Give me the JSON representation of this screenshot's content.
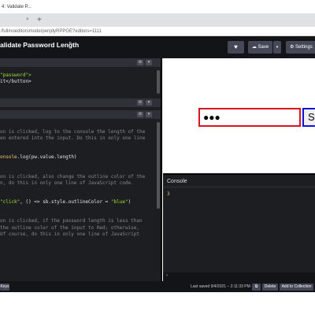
{
  "browser": {
    "tab_title": "4: Validate P...",
    "close_glyph": "×",
    "new_tab_glyph": "+",
    "url": "/full/noeditorsmode/penjdyRPPGE?editors=1111"
  },
  "header": {
    "pen_title": "alidate Password Length",
    "heart_glyph": "♥",
    "save_label": "☁ Save",
    "save_arrow": "▾",
    "settings_label": "⚙ Settings"
  },
  "editors": {
    "html_lines": [
      [
        {
          "t": "\"password\">",
          "c": "str"
        }
      ],
      [
        {
          "t": "it",
          "c": "pl"
        },
        {
          "t": "</button>",
          "c": "tg"
        }
      ]
    ],
    "js_lines": [
      [
        {
          "t": "on is clicked, log to the console the length of the",
          "c": "cm"
        }
      ],
      [
        {
          "t": "en entered into the input. Do this in only one line",
          "c": "cm"
        }
      ],
      [],
      [],
      [
        {
          "t": "onsole",
          "c": "fn"
        },
        {
          "t": ".log(pw.value.length)",
          "c": "pl"
        }
      ],
      [],
      [],
      [
        {
          "t": "on is clicked, also change the outline color of the",
          "c": "cm"
        }
      ],
      [
        {
          "t": "n, do this in only one line of JavaScript code.",
          "c": "cm"
        }
      ],
      [],
      [],
      [
        {
          "t": "\"click\"",
          "c": "str"
        },
        {
          "t": ", () => sb.style.outlineColor = ",
          "c": "pl"
        },
        {
          "t": "\"blue\"",
          "c": "str"
        },
        {
          "t": ")",
          "c": "pl"
        }
      ],
      [],
      [],
      [
        {
          "t": "on is clicked, if the password length is less than",
          "c": "cm"
        }
      ],
      [
        {
          "t": "the outline color of the input to Red; otherwise,",
          "c": "cm"
        }
      ],
      [
        {
          "t": "Of course, do this in only one line of JavaScript",
          "c": "cm"
        }
      ]
    ]
  },
  "preview": {
    "password_dots": "●●●",
    "button_label": "Su"
  },
  "console": {
    "title": "Console",
    "output": "3",
    "prompt": "›"
  },
  "footer": {
    "left_label": "Keys",
    "last_saved": "Last saved 9/4/2021 – 2:11:33 PM",
    "embed_glyph": "⧉",
    "delete_label": "Delete",
    "add_label": "Add to Collection"
  }
}
